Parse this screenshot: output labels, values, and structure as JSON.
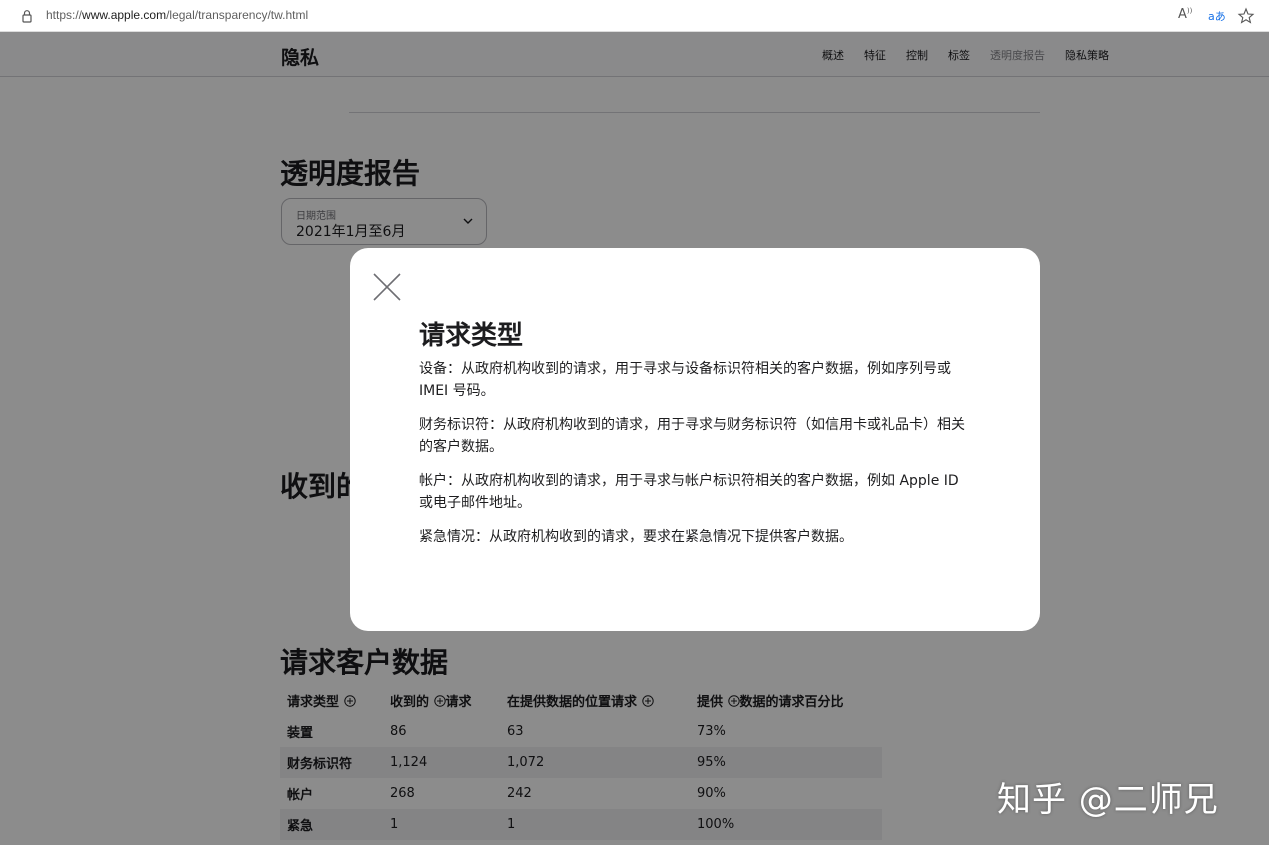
{
  "browser": {
    "url_prefix": "https://",
    "url_host": "www.apple.com",
    "url_path": "/legal/transparency/tw.html",
    "read_aloud_label": "A"
  },
  "localnav": {
    "title": "隐私",
    "links": [
      "概述",
      "特征",
      "控制",
      "标签",
      "透明度报告",
      "隐私策略"
    ]
  },
  "main": {
    "title": "透明度报告",
    "date_selector": {
      "label": "日期范围",
      "value": "2021年1月至6月"
    },
    "section_cut_title": "收到的",
    "section_title": "请求客户数据",
    "table": {
      "headers": [
        "请求类型",
        "收到的 ",
        "请求",
        "在提供数据的位置请求",
        "提供 ",
        "数据的请求百分比"
      ],
      "rows": [
        [
          "装置",
          "86",
          "63",
          "73%"
        ],
        [
          "财务标识符",
          "1,124",
          "1,072",
          "95%"
        ],
        [
          "帐户",
          "268",
          "242",
          "90%"
        ],
        [
          "紧急",
          "1",
          "1",
          "100%"
        ]
      ]
    }
  },
  "modal": {
    "title": "请求类型",
    "paragraphs": [
      "设备：从政府机构收到的请求，用于寻求与设备标识符相关的客户数据，例如序列号或 IMEI 号码。",
      "财务标识符：从政府机构收到的请求，用于寻求与财务标识符（如信用卡或礼品卡）相关的客户数据。",
      "帐户：从政府机构收到的请求，用于寻求与帐户标识符相关的客户数据，例如 Apple ID 或电子邮件地址。",
      "紧急情况：从政府机构收到的请求，要求在紧急情况下提供客户数据。"
    ]
  },
  "watermark": "知乎 @二师兄",
  "colors": {
    "scrim": "#737373",
    "text": "#1d1d1f",
    "modal_bg": "#ffffff"
  }
}
